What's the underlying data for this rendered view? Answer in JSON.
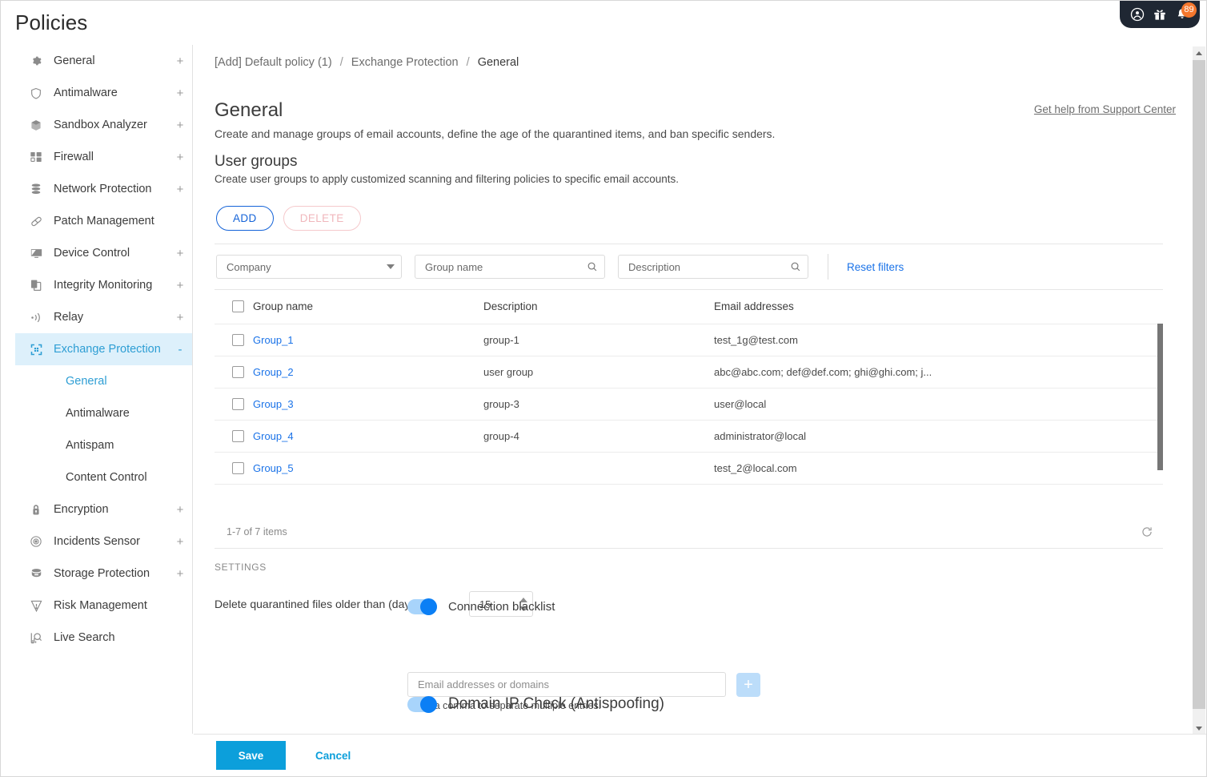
{
  "window": {
    "title": "Policies"
  },
  "topbar": {
    "icons": [
      {
        "name": "account-icon",
        "glyph": "user"
      },
      {
        "name": "gift-icon",
        "glyph": "gift"
      },
      {
        "name": "notifications-icon",
        "glyph": "bell"
      }
    ],
    "notification_count": "89",
    "bg_color": "#1f2733",
    "badge_color": "#f4772e"
  },
  "sidebar": {
    "items": [
      {
        "label": "General",
        "icon": "gear-icon",
        "expander": "+",
        "active": false
      },
      {
        "label": "Antimalware",
        "icon": "shield-icon",
        "expander": "+",
        "active": false
      },
      {
        "label": "Sandbox Analyzer",
        "icon": "cube-icon",
        "expander": "+",
        "active": false
      },
      {
        "label": "Firewall",
        "icon": "firewall-icon",
        "expander": "+",
        "active": false
      },
      {
        "label": "Network Protection",
        "icon": "stack-icon",
        "expander": "+",
        "active": false
      },
      {
        "label": "Patch Management",
        "icon": "patch-icon",
        "expander": "",
        "active": false
      },
      {
        "label": "Device Control",
        "icon": "monitor-icon",
        "expander": "+",
        "active": false
      },
      {
        "label": "Integrity Monitoring",
        "icon": "copy-icon",
        "expander": "+",
        "active": false
      },
      {
        "label": "Relay",
        "icon": "relay-icon",
        "expander": "+",
        "active": false
      },
      {
        "label": "Exchange Protection",
        "icon": "exchange-icon",
        "expander": "-",
        "active": true
      }
    ],
    "subitems": [
      {
        "label": "General",
        "active": true
      },
      {
        "label": "Antimalware",
        "active": false
      },
      {
        "label": "Antispam",
        "active": false
      },
      {
        "label": "Content Control",
        "active": false
      }
    ],
    "items_after": [
      {
        "label": "Encryption",
        "icon": "lock-icon",
        "expander": "+",
        "active": false
      },
      {
        "label": "Incidents Sensor",
        "icon": "target-icon",
        "expander": "+",
        "active": false
      },
      {
        "label": "Storage Protection",
        "icon": "storage-icon",
        "expander": "+",
        "active": false
      },
      {
        "label": "Risk Management",
        "icon": "risk-icon",
        "expander": "",
        "active": false
      },
      {
        "label": "Live Search",
        "icon": "search-chart-icon",
        "expander": "",
        "active": false
      }
    ],
    "active_color": "#2e9ed4",
    "active_bg": "#ddf0fb"
  },
  "breadcrumb": {
    "policy": "[Add] Default policy (1)",
    "section": "Exchange Protection",
    "page": "General",
    "separator": "/"
  },
  "main": {
    "support_link": "Get help from Support Center",
    "heading": "General",
    "heading_sub": "Create and manage groups of email accounts, define the age of the quarantined items, and ban specific senders.",
    "section_heading": "User groups",
    "section_sub": "Create user groups to apply customized scanning and filtering policies to specific email accounts.",
    "buttons": {
      "add": "ADD",
      "delete": "DELETE"
    },
    "filters": {
      "company_label": "Company",
      "group_name_placeholder": "Group name",
      "description_placeholder": "Description",
      "reset": "Reset filters"
    },
    "table": {
      "columns": [
        "Group name",
        "Description",
        "Email addresses"
      ],
      "rows": [
        {
          "name": "Group_1",
          "description": "group-1",
          "emails": "test_1g@test.com"
        },
        {
          "name": "Group_2",
          "description": "user group",
          "emails": "abc@abc.com; def@def.com; ghi@ghi.com; j..."
        },
        {
          "name": "Group_3",
          "description": "group-3",
          "emails": "user@local"
        },
        {
          "name": "Group_4",
          "description": "group-4",
          "emails": "administrator@local"
        },
        {
          "name": "Group_5",
          "description": "",
          "emails": "test_2@local.com"
        }
      ],
      "footer_count": "1-7 of 7 items",
      "refresh_icon": "refresh-icon"
    },
    "settings": {
      "label": "SETTINGS",
      "quarantine_label": "Delete quarantined files older than (days):",
      "quarantine_value": "15",
      "connection_blacklist_label": "Connection blacklist",
      "connection_blacklist_on": true,
      "blacklist_placeholder": "Email addresses or domains",
      "blacklist_add": "+",
      "blacklist_hint": "Use a comma to separate multiple entries.",
      "domain_ip_label": "Domain IP Check (Antispoofing)",
      "domain_ip_on": true
    }
  },
  "actions": {
    "save": "Save",
    "cancel": "Cancel",
    "save_color": "#0c9fdb"
  }
}
